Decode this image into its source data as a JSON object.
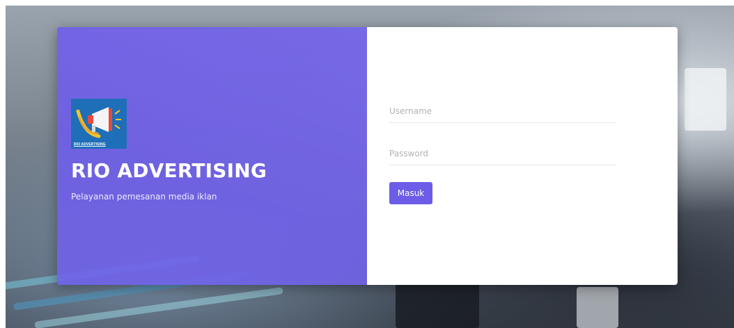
{
  "brand": {
    "logo_text": "RIO ADVERTISING",
    "title": "RIO ADVERTISING",
    "subtitle": "Pelayanan pemesanan media iklan"
  },
  "form": {
    "username_placeholder": "Username",
    "password_placeholder": "Password",
    "submit_label": "Masuk"
  },
  "colors": {
    "accent": "#6c5ce7",
    "panel": "#ffffff",
    "logo_bg": "#1f6fb8"
  },
  "icons": {
    "logo": "megaphone-icon"
  }
}
